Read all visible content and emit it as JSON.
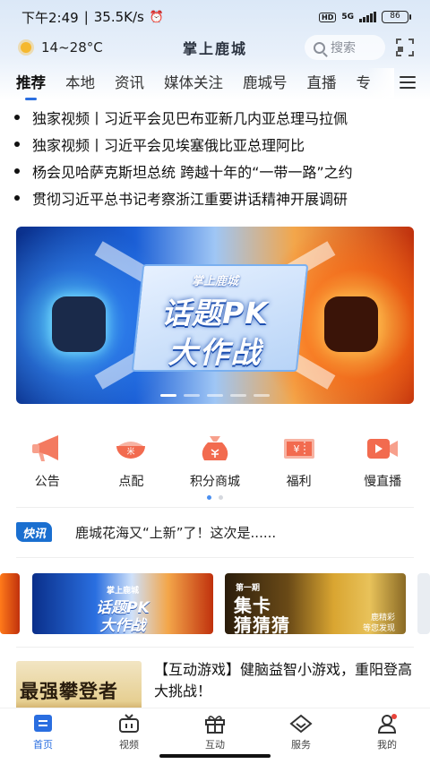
{
  "status_bar": {
    "time": "下午2:49",
    "net_speed": "35.5K/s",
    "hd": "HD",
    "network": "5G",
    "battery": "86"
  },
  "header": {
    "weather_temp": "14~28°C",
    "weather_icon": "sun-icon",
    "app_title": "掌上鹿城",
    "search_placeholder": "搜索"
  },
  "tabs": [
    "推荐",
    "本地",
    "资讯",
    "媒体关注",
    "鹿城号",
    "直播",
    "专"
  ],
  "active_tab": 0,
  "headlines": [
    "独家视频丨习近平会见巴布亚新几内亚总理马拉佩",
    "独家视频丨习近平会见埃塞俄比亚总理阿比",
    "杨会见哈萨克斯坦总统 跨越十年的“一带一路”之约",
    "贯彻习近平总书记考察浙江重要讲话精神开展调研"
  ],
  "banner": {
    "brand": "掌上鹿城",
    "line1": "话题PK",
    "line2": "大作战",
    "slide_count": 5,
    "active_slide": 0
  },
  "quick_entries": [
    {
      "label": "公告",
      "icon": "megaphone-icon",
      "color": "#f26b4f"
    },
    {
      "label": "点配",
      "icon": "bowl-icon",
      "color": "#f26b4f"
    },
    {
      "label": "积分商城",
      "icon": "money-bag-icon",
      "color": "#f26b4f"
    },
    {
      "label": "福利",
      "icon": "ticket-icon",
      "color": "#f26b4f"
    },
    {
      "label": "慢直播",
      "icon": "video-camera-icon",
      "color": "#f26b4f"
    }
  ],
  "quick_page": {
    "total": 2,
    "active": 0
  },
  "flash_news": {
    "badge": "快讯",
    "text": "鹿城花海又“上新”了！这次是......"
  },
  "promos": {
    "card1": {
      "brand": "掌上鹿城",
      "line1": "话题PK",
      "line2": "大作战"
    },
    "card2": {
      "issue": "第一期",
      "line1": "集卡",
      "line2": "猜猜猜",
      "note1": "鹿精彩",
      "note2": "等您发现"
    }
  },
  "feed": {
    "thumb_text": "最强攀登者",
    "title": "【互动游戏】健脑益智小游戏，重阳登高大挑战！"
  },
  "bottom_nav": [
    {
      "label": "首页",
      "icon": "home-icon"
    },
    {
      "label": "视频",
      "icon": "tv-icon"
    },
    {
      "label": "互动",
      "icon": "gift-icon"
    },
    {
      "label": "服务",
      "icon": "diamond-icon"
    },
    {
      "label": "我的",
      "icon": "user-icon"
    }
  ],
  "colors": {
    "accent": "#2a6ee0",
    "icon_red": "#f26b4f",
    "flash_badge": "#1a6fd0"
  }
}
